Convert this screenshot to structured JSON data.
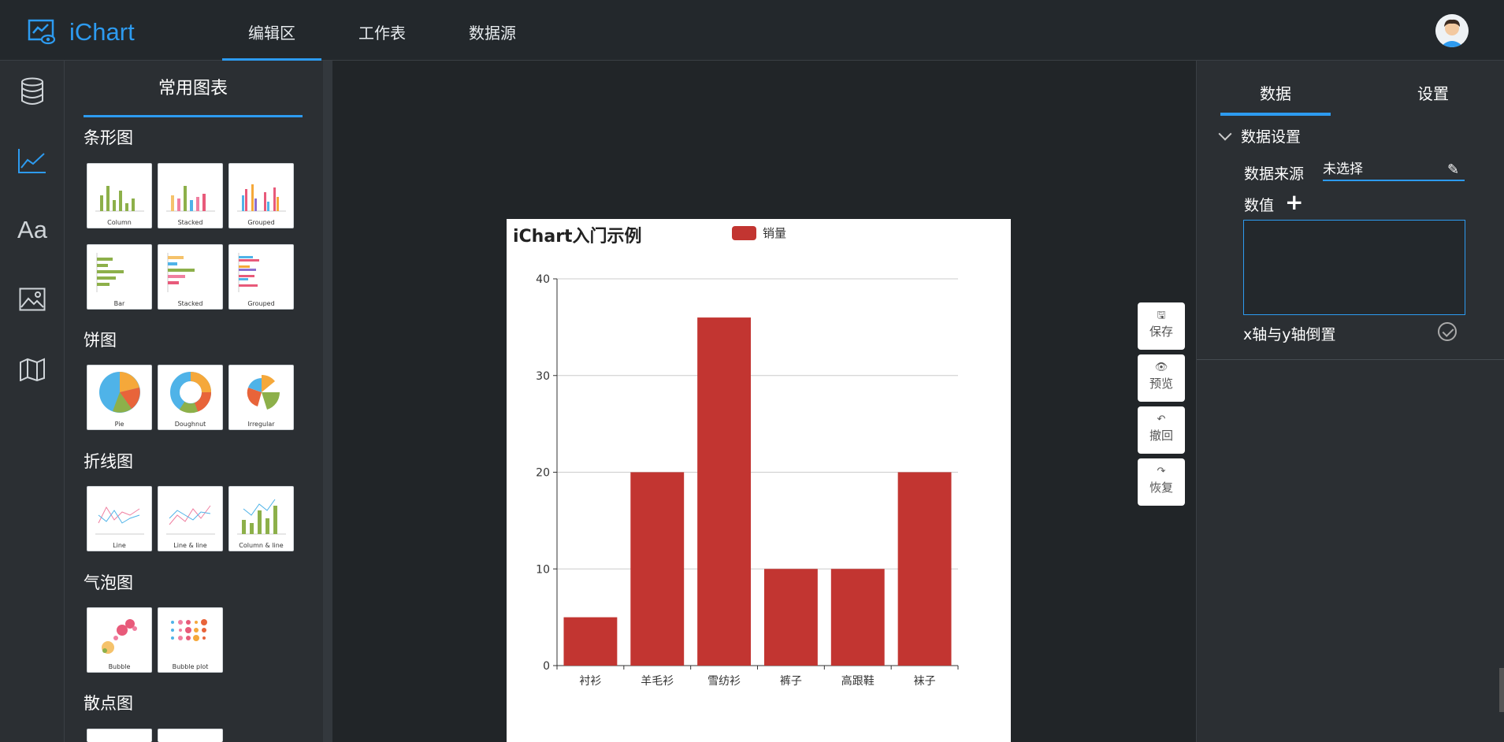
{
  "app": {
    "name": "iChart",
    "brand_color": "#2d9bf0"
  },
  "topnav": {
    "tabs": [
      {
        "label": "编辑区",
        "active": true
      },
      {
        "label": "工作表",
        "active": false
      },
      {
        "label": "数据源",
        "active": false
      }
    ]
  },
  "sidebar": {
    "icons": [
      "database-icon",
      "line-chart-icon",
      "text-icon",
      "image-icon",
      "map-icon"
    ],
    "active": "line-chart-icon",
    "text_icon_label": "Aa"
  },
  "palette": {
    "title": "常用图表",
    "groups": [
      {
        "label": "条形图",
        "items": [
          "Column",
          "Stacked",
          "Grouped",
          "Bar",
          "Stacked",
          "Grouped"
        ]
      },
      {
        "label": "饼图",
        "items": [
          "Pie",
          "Doughnut",
          "Irregular"
        ]
      },
      {
        "label": "折线图",
        "items": [
          "Line",
          "Line & line",
          "Column & line"
        ]
      },
      {
        "label": "气泡图",
        "items": [
          "Bubble",
          "Bubble plot"
        ]
      },
      {
        "label": "散点图",
        "items": []
      }
    ]
  },
  "float_buttons": [
    {
      "label": "保存",
      "icon": "save-icon",
      "glyph": "🖫"
    },
    {
      "label": "预览",
      "icon": "eye-icon",
      "glyph": "👁"
    },
    {
      "label": "撤回",
      "icon": "undo-icon",
      "glyph": "↶"
    },
    {
      "label": "恢复",
      "icon": "redo-icon",
      "glyph": "↷"
    }
  ],
  "right_panel": {
    "tabs": [
      {
        "label": "数据",
        "active": true
      },
      {
        "label": "设置",
        "active": false
      }
    ],
    "section_title": "数据设置",
    "data_source_label": "数据来源",
    "data_source_value": "未选择",
    "values_label": "数值",
    "plus_glyph": "+",
    "pencil_glyph": "✎",
    "swap_axes_label": "x轴与y轴倒置"
  },
  "chart_data": {
    "type": "bar",
    "title": "iChart入门示例",
    "categories": [
      "衬衫",
      "羊毛衫",
      "雪纺衫",
      "裤子",
      "高跟鞋",
      "袜子"
    ],
    "series": [
      {
        "name": "销量",
        "values": [
          5,
          20,
          36,
          10,
          10,
          20
        ],
        "color": "#c23531"
      }
    ],
    "ylim": [
      0,
      40
    ],
    "yticks": [
      0,
      10,
      20,
      30,
      40
    ],
    "grid": true,
    "legend": "top-center"
  }
}
